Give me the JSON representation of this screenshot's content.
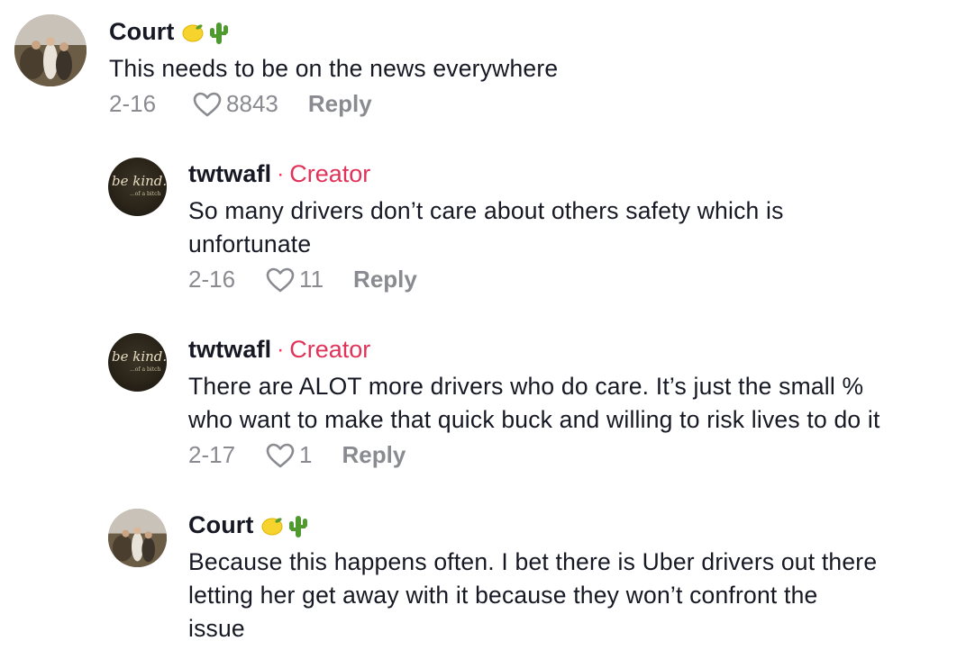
{
  "comments": [
    {
      "username": "Court",
      "emoji": [
        "lemon",
        "cactus"
      ],
      "text": "This needs to be on the news everywhere",
      "date": "2-16",
      "likes": "8843",
      "reply_label": "Reply"
    },
    {
      "username": "twtwafl",
      "badge": "Creator",
      "text_lines": [
        "So many drivers don’t care about others safety which is",
        "unfortunate"
      ],
      "date": "2-16",
      "likes": "11",
      "reply_label": "Reply"
    },
    {
      "username": "twtwafl",
      "badge": "Creator",
      "text_lines": [
        "There are ALOT more drivers who do care. It’s just the small %",
        "who want to make that quick buck and willing to risk lives to do it"
      ],
      "date": "2-17",
      "likes": "1",
      "reply_label": "Reply"
    },
    {
      "username": "Court",
      "emoji": [
        "lemon",
        "cactus"
      ],
      "text_lines": [
        "Because this happens often. I bet there is Uber drivers out there",
        "letting her get away with it because they won’t confront the",
        "issue"
      ]
    }
  ],
  "colors": {
    "creator_badge": "#e1335a",
    "meta_gray": "#8a8b91",
    "text": "#161823"
  },
  "icons": [
    "heart-outline-icon",
    "lemon-emoji-icon",
    "cactus-emoji-icon"
  ]
}
